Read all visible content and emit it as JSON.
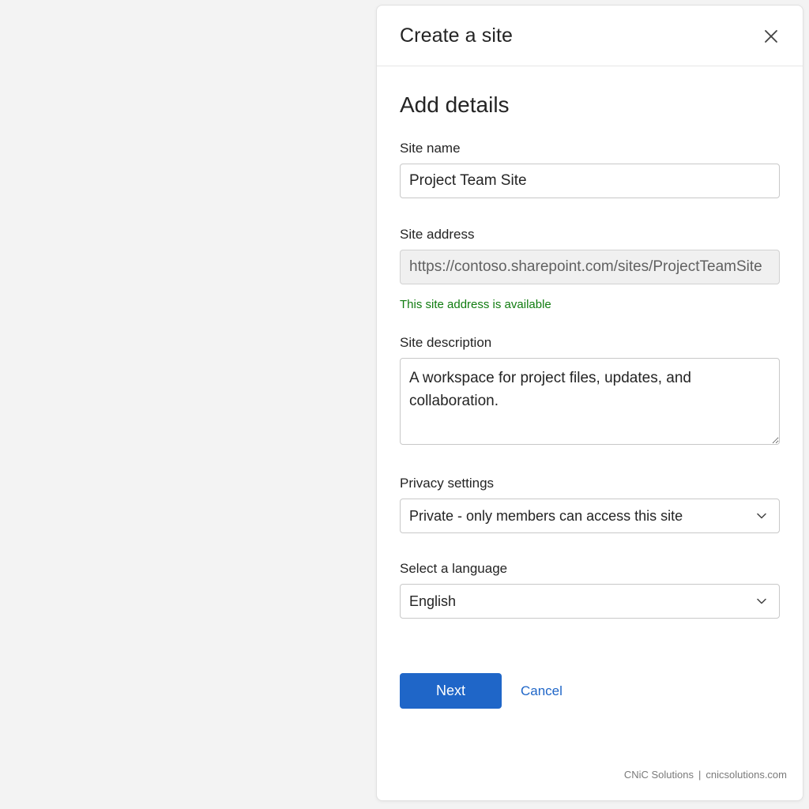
{
  "dialog": {
    "title": "Create a site",
    "close_icon": "close-icon"
  },
  "form": {
    "heading": "Add details",
    "site_name": {
      "label": "Site name",
      "value": "Project Team Site"
    },
    "site_address": {
      "label": "Site address",
      "value": "https://contoso.sharepoint.com/sites/ProjectTeamSite",
      "status": "This site address is available"
    },
    "site_description": {
      "label": "Site description",
      "value": "A workspace for project files, updates, and collaboration."
    },
    "privacy": {
      "label": "Privacy settings",
      "selected": "Private - only members can access this site"
    },
    "language": {
      "label": "Select a language",
      "selected": "English"
    }
  },
  "actions": {
    "next_label": "Next",
    "cancel_label": "Cancel"
  },
  "footer": {
    "brand": "CNiC Solutions",
    "separator": "|",
    "domain": "cnicsolutions.com"
  },
  "colors": {
    "primary": "#1f66c8",
    "success": "#107c10",
    "background": "#f3f3f3",
    "panel": "#ffffff"
  }
}
